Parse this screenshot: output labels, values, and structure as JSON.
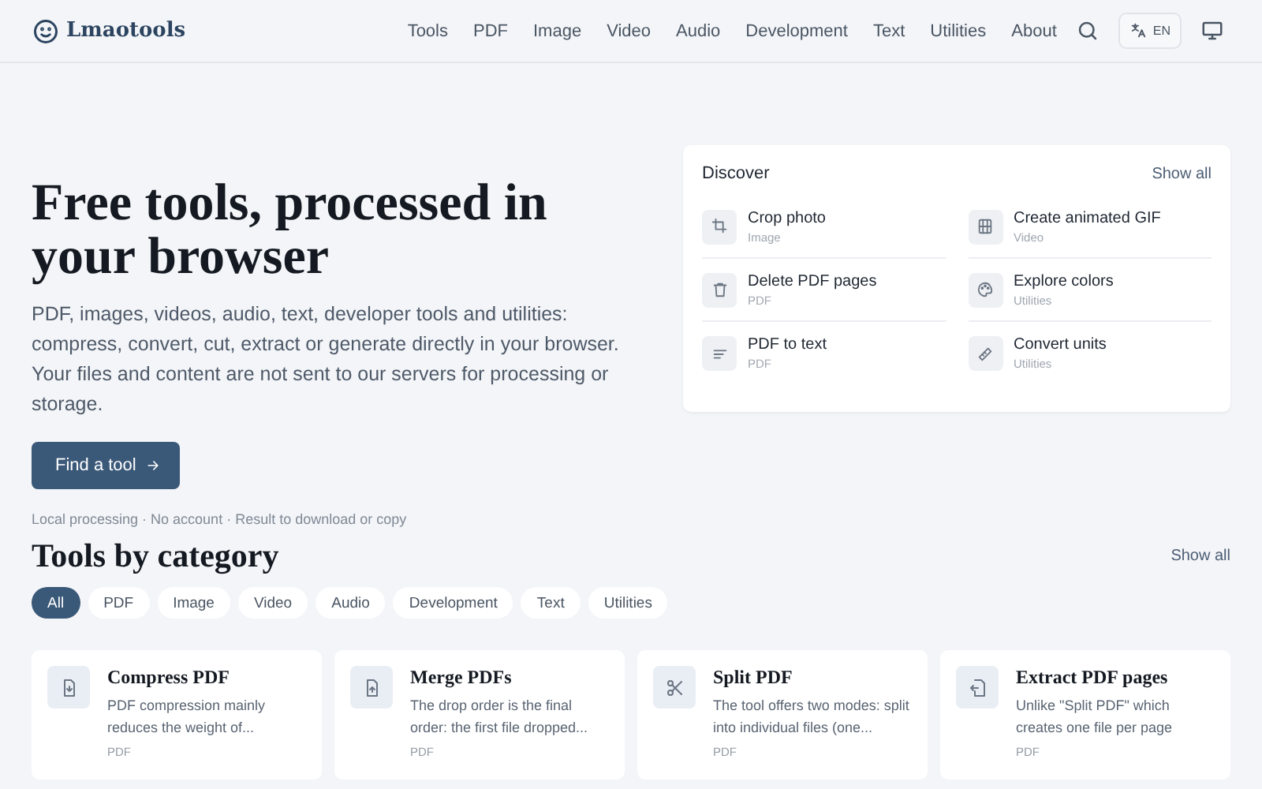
{
  "header": {
    "logo": "Lmaotools",
    "nav": [
      "Tools",
      "PDF",
      "Image",
      "Video",
      "Audio",
      "Development",
      "Text",
      "Utilities",
      "About"
    ],
    "language": "EN"
  },
  "hero": {
    "title": "Free tools, processed in your browser",
    "text": "PDF, images, videos, audio, text, developer tools and utilities: compress, convert, cut, extract or generate directly in your browser. Your files and content are not sent to our servers for processing or storage.",
    "button": "Find a tool",
    "note": "Local processing · No account · Result to download or copy"
  },
  "discover": {
    "title": "Discover",
    "link": "Show all",
    "items": [
      {
        "name": "Crop photo",
        "category": "Image"
      },
      {
        "name": "Create animated GIF",
        "category": "Video"
      },
      {
        "name": "Delete PDF pages",
        "category": "PDF"
      },
      {
        "name": "Explore colors",
        "category": "Utilities"
      },
      {
        "name": "PDF to text",
        "category": "PDF"
      },
      {
        "name": "Convert units",
        "category": "Utilities"
      }
    ]
  },
  "categories": {
    "title": "Tools by category",
    "link": "Show all",
    "filters": [
      {
        "label": "All",
        "selected": true
      },
      {
        "label": "PDF",
        "selected": false
      },
      {
        "label": "Image",
        "selected": false
      },
      {
        "label": "Video",
        "selected": false
      },
      {
        "label": "Audio",
        "selected": false
      },
      {
        "label": "Development",
        "selected": false
      },
      {
        "label": "Text",
        "selected": false
      },
      {
        "label": "Utilities",
        "selected": false
      }
    ],
    "tools": [
      {
        "name": "Compress PDF",
        "description": "PDF compression mainly reduces the weight of...",
        "category": "PDF"
      },
      {
        "name": "Merge PDFs",
        "description": "The drop order is the final order: the first file dropped...",
        "category": "PDF"
      },
      {
        "name": "Split PDF",
        "description": "The tool offers two modes: split into individual files (one...",
        "category": "PDF"
      },
      {
        "name": "Extract PDF pages",
        "description": "Unlike \"Split PDF\" which creates one file per page",
        "category": "PDF"
      }
    ]
  }
}
